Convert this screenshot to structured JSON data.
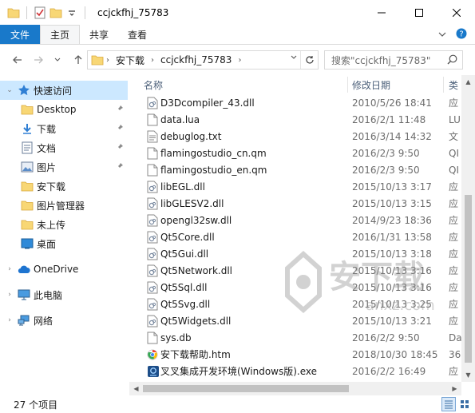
{
  "window": {
    "title": "ccjckfhj_75783",
    "controls": {
      "minimize": "—",
      "maximize": "☐",
      "close": "✕"
    }
  },
  "ribbon": {
    "tabs": [
      "文件",
      "主页",
      "共享",
      "查看"
    ],
    "active_tab": "主页"
  },
  "address": {
    "crumbs": [
      "安下载",
      "ccjckfhj_75783"
    ],
    "search_placeholder": "搜索\"ccjckfhj_75783\""
  },
  "nav": {
    "quick_access": "快速访问",
    "items": [
      {
        "label": "Desktop",
        "icon": "folder-icon",
        "pinned": true
      },
      {
        "label": "下载",
        "icon": "download-icon",
        "pinned": true
      },
      {
        "label": "文档",
        "icon": "documents-icon",
        "pinned": true
      },
      {
        "label": "图片",
        "icon": "pictures-icon",
        "pinned": true
      },
      {
        "label": "安下载",
        "icon": "folder-icon",
        "pinned": false
      },
      {
        "label": "图片管理器",
        "icon": "folder-icon",
        "pinned": false
      },
      {
        "label": "未上传",
        "icon": "folder-icon",
        "pinned": false
      },
      {
        "label": "桌面",
        "icon": "desktop-icon",
        "pinned": false
      }
    ],
    "onedrive": "OneDrive",
    "this_pc": "此电脑",
    "network": "网络"
  },
  "columns": {
    "name": "名称",
    "date": "修改日期",
    "type": "类"
  },
  "files": [
    {
      "name": "D3Dcompiler_43.dll",
      "date": "2010/5/26 18:41",
      "type": "应",
      "icon": "dll-icon"
    },
    {
      "name": "data.lua",
      "date": "2016/2/1 11:48",
      "type": "LU",
      "icon": "file-icon"
    },
    {
      "name": "debuglog.txt",
      "date": "2016/3/14 14:32",
      "type": "文",
      "icon": "text-icon"
    },
    {
      "name": "flamingostudio_cn.qm",
      "date": "2016/2/3 9:50",
      "type": "QI",
      "icon": "file-icon"
    },
    {
      "name": "flamingostudio_en.qm",
      "date": "2016/2/3 9:50",
      "type": "QI",
      "icon": "file-icon"
    },
    {
      "name": "libEGL.dll",
      "date": "2015/10/13 3:17",
      "type": "应",
      "icon": "dll-icon"
    },
    {
      "name": "libGLESV2.dll",
      "date": "2015/10/13 3:15",
      "type": "应",
      "icon": "dll-icon"
    },
    {
      "name": "opengl32sw.dll",
      "date": "2014/9/23 18:36",
      "type": "应",
      "icon": "dll-icon"
    },
    {
      "name": "Qt5Core.dll",
      "date": "2016/1/31 13:58",
      "type": "应",
      "icon": "dll-icon"
    },
    {
      "name": "Qt5Gui.dll",
      "date": "2015/10/13 3:18",
      "type": "应",
      "icon": "dll-icon"
    },
    {
      "name": "Qt5Network.dll",
      "date": "2015/10/13 3:16",
      "type": "应",
      "icon": "dll-icon"
    },
    {
      "name": "Qt5Sql.dll",
      "date": "2015/10/13 3:16",
      "type": "应",
      "icon": "dll-icon"
    },
    {
      "name": "Qt5Svg.dll",
      "date": "2015/10/13 3:25",
      "type": "应",
      "icon": "dll-icon"
    },
    {
      "name": "Qt5Widgets.dll",
      "date": "2015/10/13 3:21",
      "type": "应",
      "icon": "dll-icon"
    },
    {
      "name": "sys.db",
      "date": "2016/2/2 9:50",
      "type": "Da",
      "icon": "file-icon"
    },
    {
      "name": "安下载帮助.htm",
      "date": "2018/10/30 18:45",
      "type": "36",
      "icon": "htm-icon"
    },
    {
      "name": "叉叉集成开发环境(Windows版).exe",
      "date": "2016/2/2 16:49",
      "type": "应",
      "icon": "exe-icon"
    }
  ],
  "status": {
    "item_count": "27 个项目"
  },
  "watermark": {
    "text": "安下载",
    "url": "anxz.com"
  },
  "colors": {
    "accent": "#1979ca",
    "selection": "#cce8ff",
    "folder": "#f8d775"
  }
}
